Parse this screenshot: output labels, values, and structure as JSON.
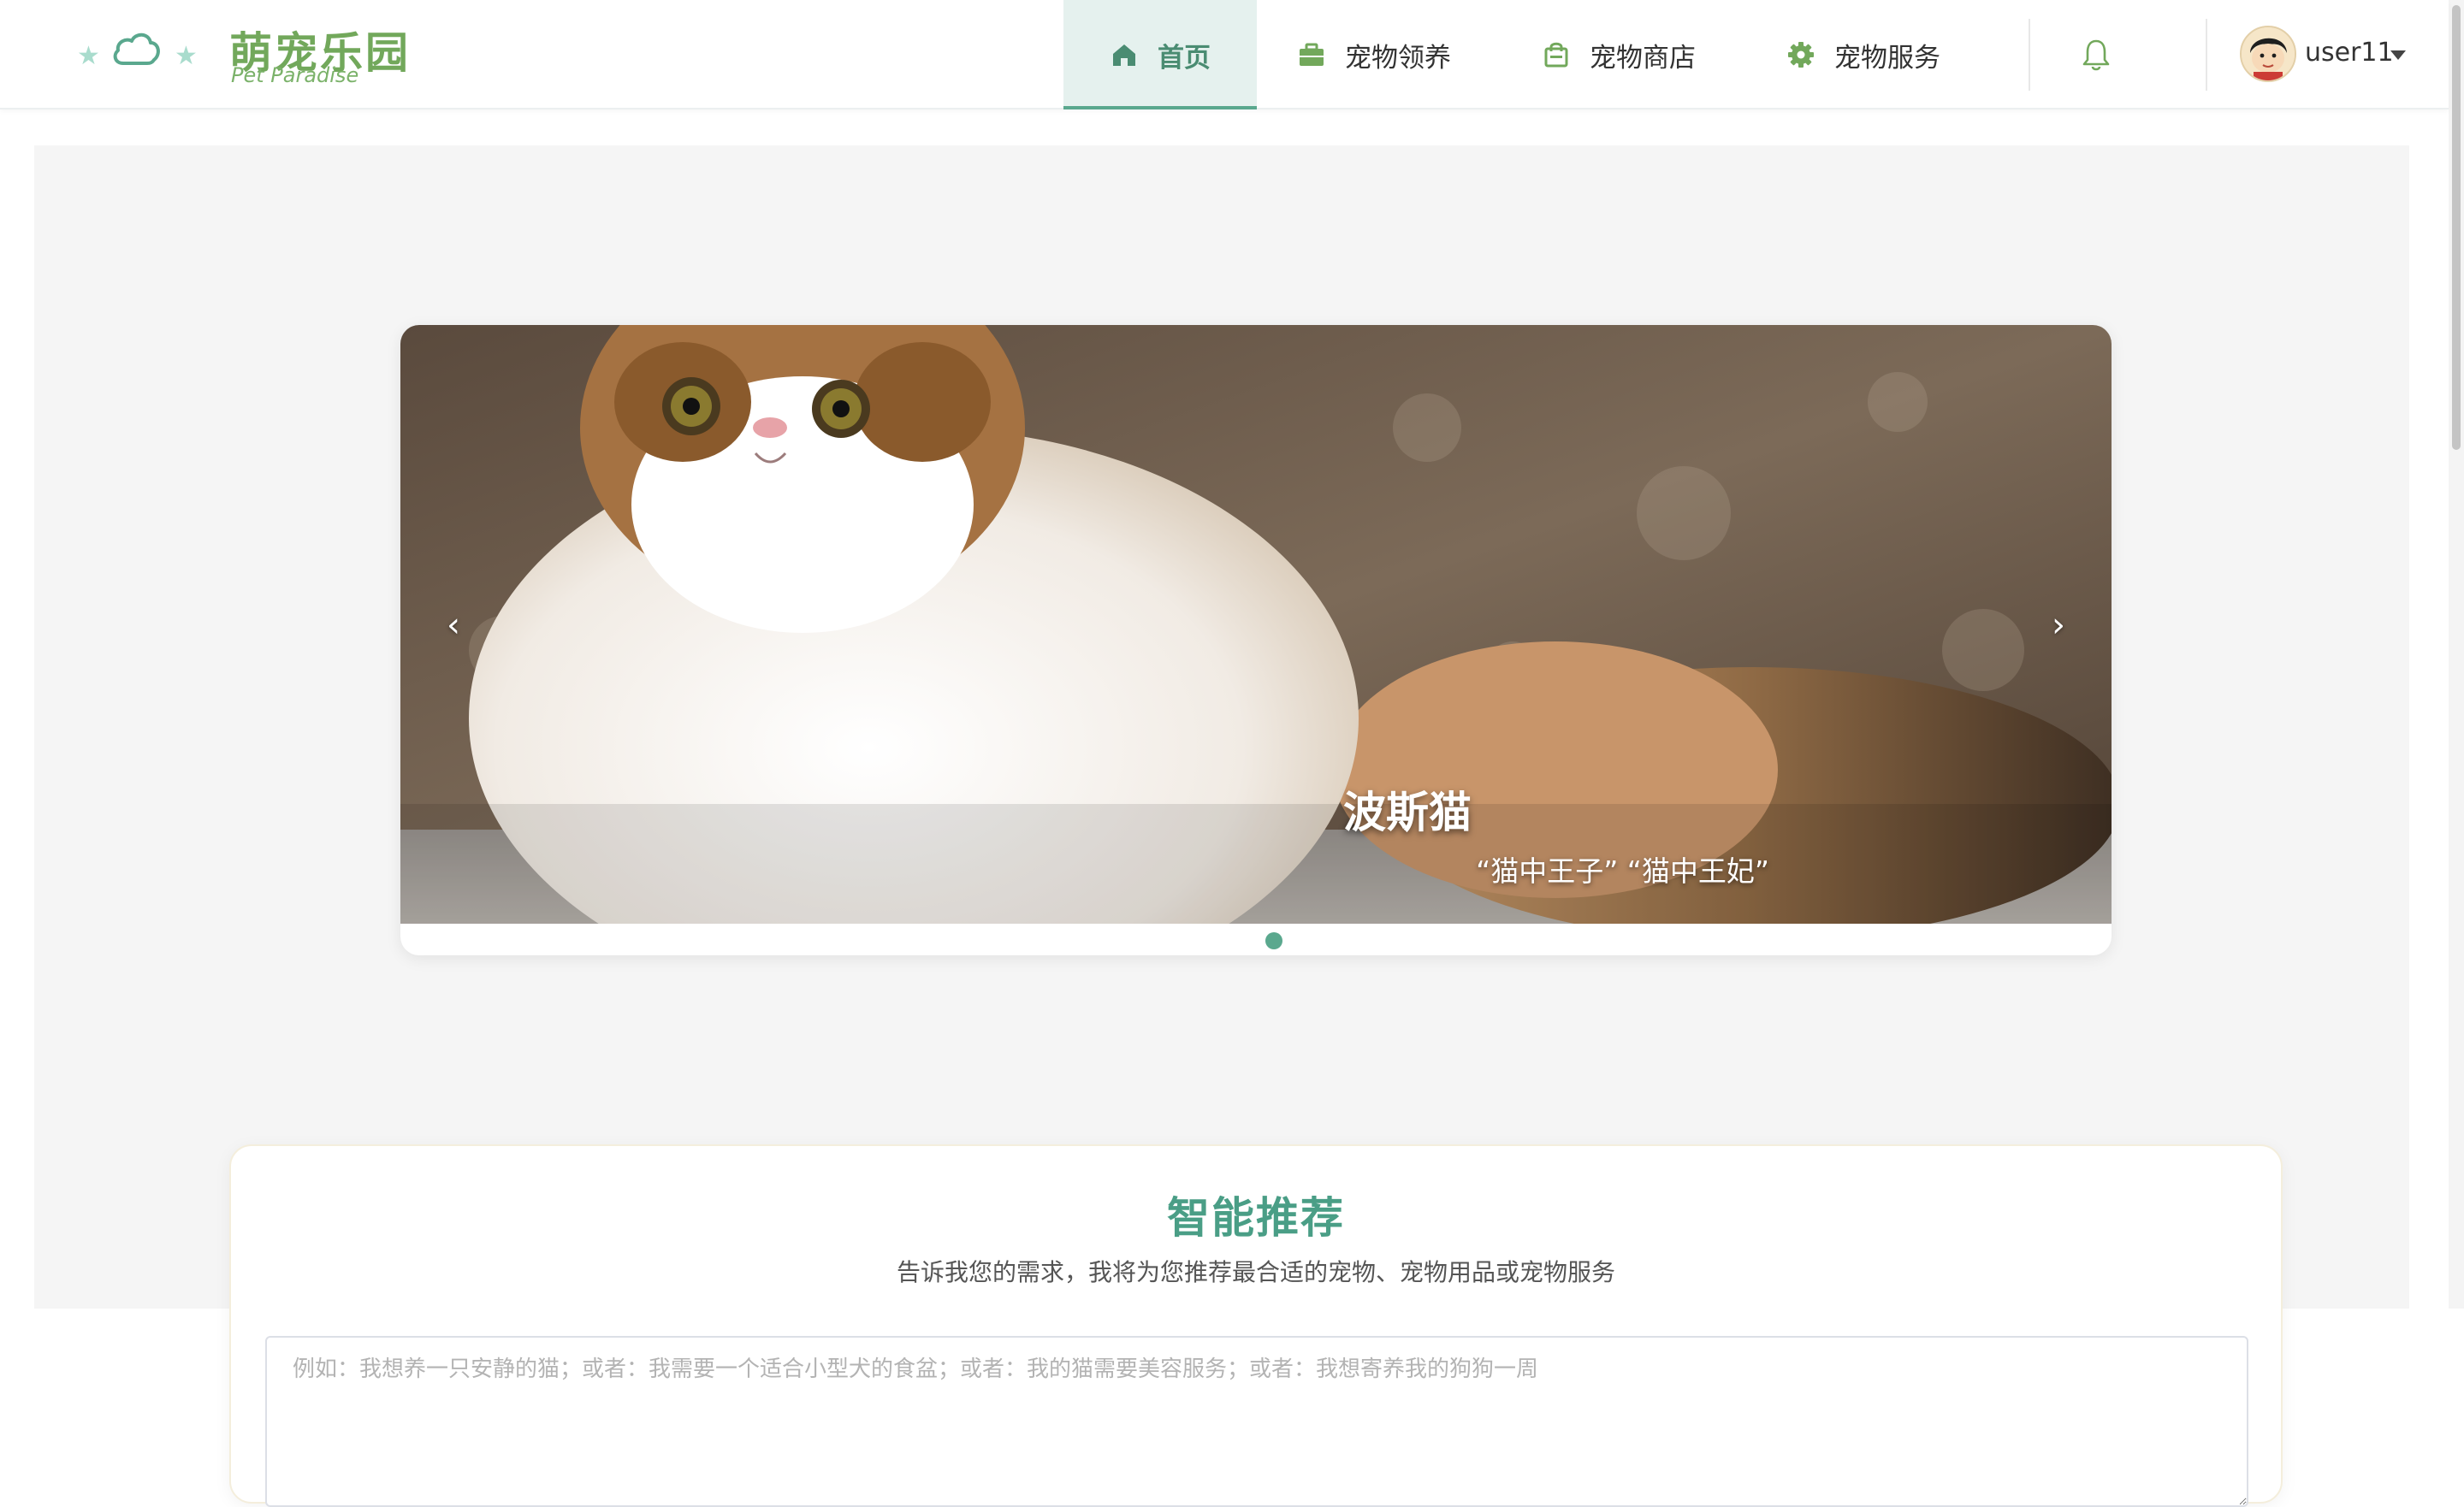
{
  "brand": {
    "title": "萌宠乐园",
    "subtitle": "Pet Paradise"
  },
  "nav": {
    "items": [
      {
        "label": "首页",
        "icon": "home-icon",
        "active": true
      },
      {
        "label": "宠物领养",
        "icon": "briefcase-icon",
        "active": false
      },
      {
        "label": "宠物商店",
        "icon": "shopping-bag-icon",
        "active": false
      },
      {
        "label": "宠物服务",
        "icon": "gear-icon",
        "active": false
      }
    ]
  },
  "user": {
    "name": "user11"
  },
  "carousel": {
    "slide_title": "波斯猫",
    "slide_subtitle": "“猫中王子” “猫中王妃”",
    "prev_label": "‹",
    "next_label": "›",
    "slide_count": 1,
    "active_index": 0
  },
  "recommend": {
    "title": "智能推荐",
    "subtitle": "告诉我您的需求，我将为您推荐最合适的宠物、宠物用品或宠物服务",
    "placeholder": "例如：我想养一只安静的猫；或者：我需要一个适合小型犬的食盆；或者：我的猫需要美容服务；或者：我想寄养我的狗狗一周",
    "value": ""
  },
  "colors": {
    "brand_green": "#72a85b",
    "accent_teal": "#5aa88e",
    "active_nav_bg": "#e5f1ee"
  }
}
